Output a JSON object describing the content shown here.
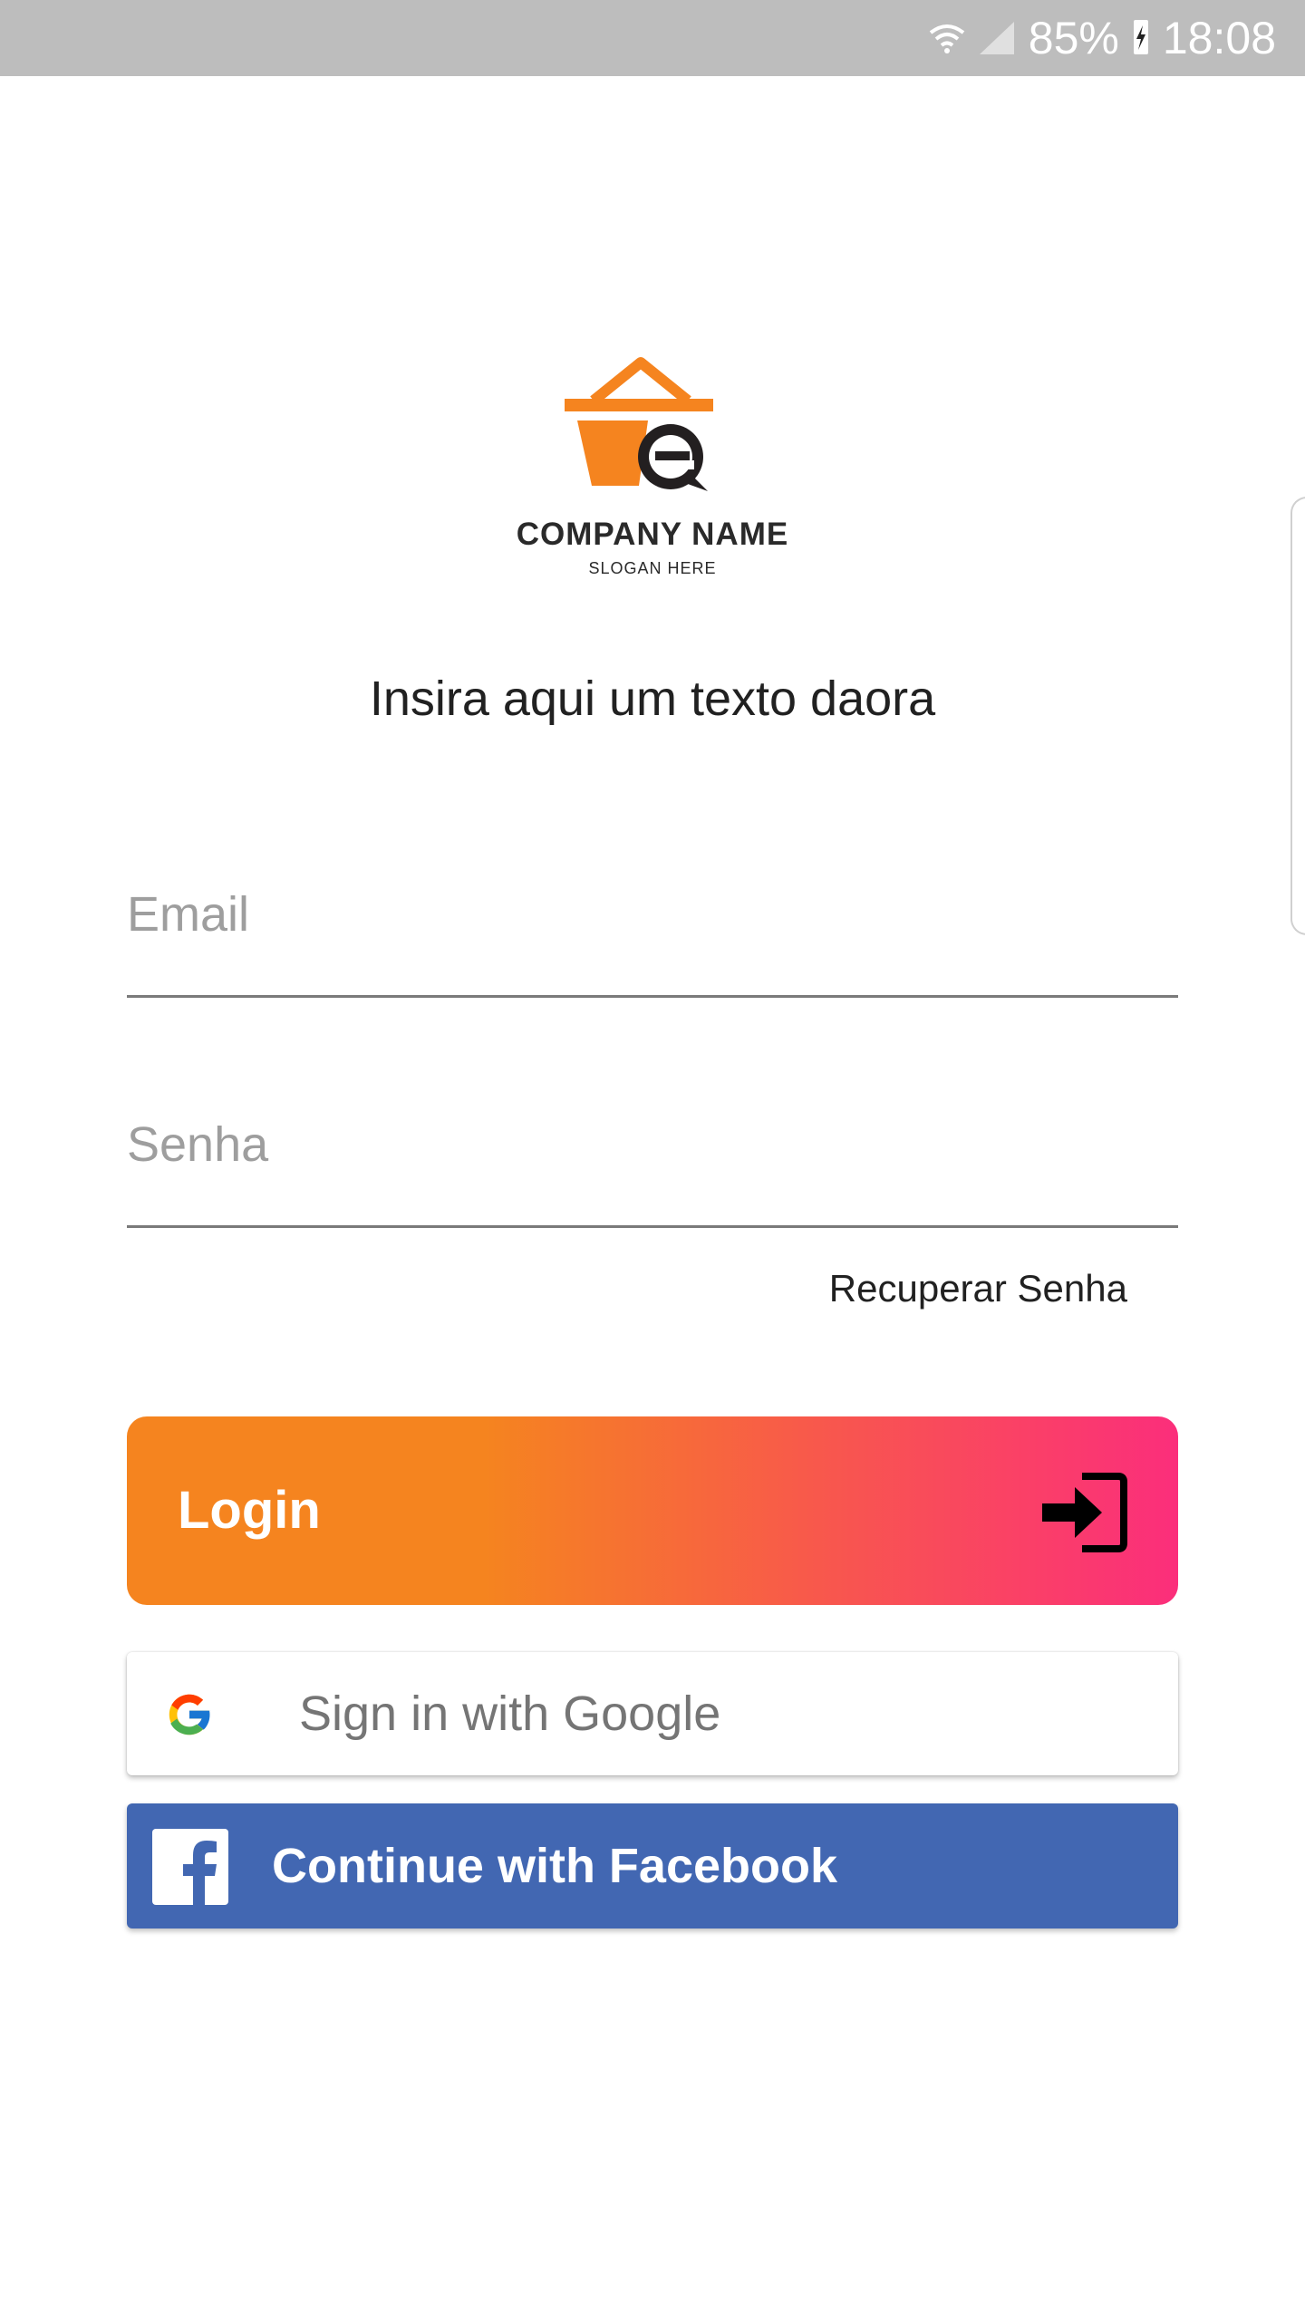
{
  "status_bar": {
    "battery": "85%",
    "time": "18:08",
    "icons": [
      "wifi-icon",
      "signal-icon",
      "battery-charging-icon"
    ]
  },
  "logo": {
    "company_name": "COMPANY NAME",
    "slogan": "SLOGAN HERE",
    "colors": {
      "basket": "#f5841f",
      "letter": "#231f20"
    }
  },
  "tagline": "Insira aqui um texto daora",
  "form": {
    "email_placeholder": "Email",
    "password_placeholder": "Senha",
    "recover_label": "Recuperar Senha"
  },
  "login": {
    "label": "Login",
    "icon": "login-arrow-icon",
    "gradient": [
      "#f5841f",
      "#fb2e7b"
    ]
  },
  "google": {
    "label": "Sign in with Google",
    "icon": "google-g-icon"
  },
  "facebook": {
    "label": "Continue with Facebook",
    "icon": "facebook-f-icon",
    "color": "#4267b2"
  }
}
